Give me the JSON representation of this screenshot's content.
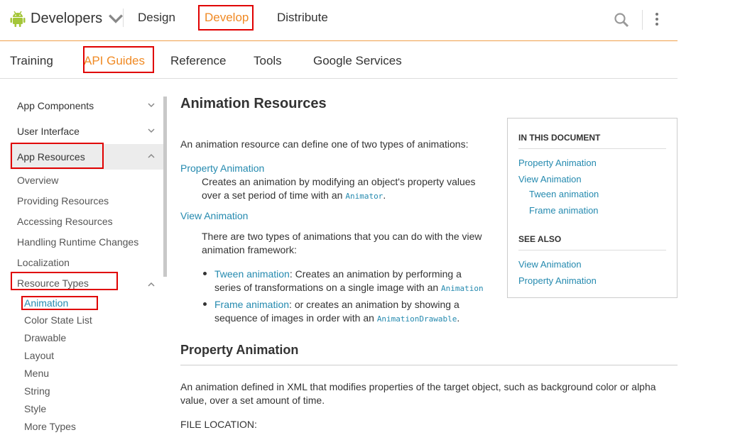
{
  "header": {
    "brand": "Developers",
    "nav": [
      "Design",
      "Develop",
      "Distribute"
    ],
    "active_nav": "Develop",
    "icons": {
      "search": "search-icon",
      "menu": "more-vert-icon",
      "logo": "android-logo-icon"
    }
  },
  "subnav": {
    "items": [
      "Training",
      "API Guides",
      "Reference",
      "Tools",
      "Google Services"
    ],
    "active": "API Guides"
  },
  "sidebar": {
    "sections": [
      "App Components",
      "User Interface",
      "App Resources"
    ],
    "app_resources_items": [
      "Overview",
      "Providing Resources",
      "Accessing Resources",
      "Handling Runtime Changes",
      "Localization",
      "Resource Types"
    ],
    "resource_types_items": [
      "Animation",
      "Color State List",
      "Drawable",
      "Layout",
      "Menu",
      "String",
      "Style",
      "More Types"
    ],
    "active_item": "Animation"
  },
  "content": {
    "title": "Animation Resources",
    "intro": "An animation resource can define one of two types of animations:",
    "property_animation_link": "Property Animation",
    "property_animation_desc_1": "Creates an animation by modifying an object's property values",
    "property_animation_desc_2": "over a set period of time with an ",
    "animator_code": "Animator",
    "period": ".",
    "view_animation_link": "View Animation",
    "view_animation_desc_1": "There are two types of animations that you can do with the view",
    "view_animation_desc_2": "animation framework:",
    "tween_link": "Tween animation",
    "tween_desc_1": ": Creates an animation by performing a",
    "tween_desc_2": "series of transformations on a single image with an ",
    "animation_code": "Animation",
    "frame_link": "Frame animation",
    "frame_desc_1": ": or creates an animation by showing a",
    "frame_desc_2": "sequence of images in order with an ",
    "animation_drawable_code": "AnimationDrawable",
    "section_title": "Property Animation",
    "section_desc_1": "An animation defined in XML that modifies properties of the target object, such as background color or alpha",
    "section_desc_2": "value, over a set amount of time.",
    "file_location": "FILE LOCATION:"
  },
  "toc": {
    "heading_1": "IN THIS DOCUMENT",
    "links_1": [
      "Property Animation",
      "View Animation",
      "Tween animation",
      "Frame animation"
    ],
    "heading_2": "SEE ALSO",
    "links_2": [
      "View Animation",
      "Property Animation"
    ]
  },
  "colors": {
    "accent": "#f08a24",
    "link": "#258aaf",
    "highlight_box": "#e00000"
  }
}
